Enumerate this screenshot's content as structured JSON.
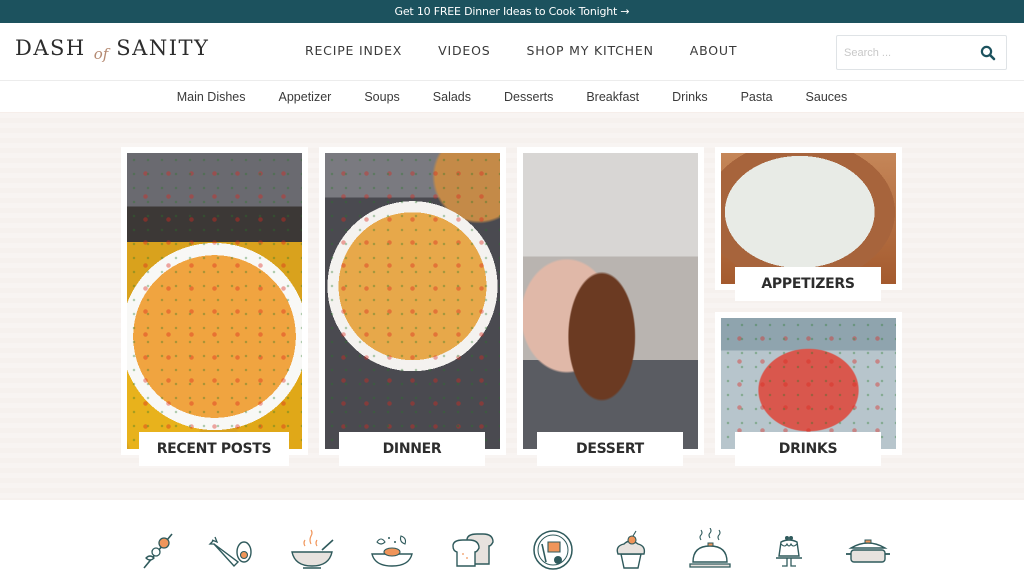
{
  "announcement": {
    "text": "Get 10 FREE Dinner Ideas to Cook Tonight →"
  },
  "header": {
    "logo": {
      "part1": "DASH",
      "part2": "of",
      "part3": "SANITY"
    },
    "nav": [
      {
        "label": "RECIPE INDEX"
      },
      {
        "label": "VIDEOS"
      },
      {
        "label": "SHOP MY KITCHEN"
      },
      {
        "label": "ABOUT"
      }
    ],
    "search": {
      "placeholder": "Search ...",
      "value": "",
      "icon": "search-icon"
    }
  },
  "subnav": [
    {
      "label": "Main Dishes"
    },
    {
      "label": "Appetizer"
    },
    {
      "label": "Soups"
    },
    {
      "label": "Salads"
    },
    {
      "label": "Desserts"
    },
    {
      "label": "Breakfast"
    },
    {
      "label": "Drinks"
    },
    {
      "label": "Pasta"
    },
    {
      "label": "Sauces"
    }
  ],
  "cards": [
    {
      "label": "RECENT POSTS",
      "image": "queso dip in white bowl with tortilla chips"
    },
    {
      "label": "DINNER",
      "image": "chicken pasta soup in white bowl"
    },
    {
      "label": "DESSERT",
      "image": "hand holding chocolate cornflake cluster"
    },
    {
      "label": "APPETIZERS",
      "image": "creamy herb dip in wooden bowl"
    },
    {
      "label": "DRINKS",
      "image": "red punch with citrus and mint in glass"
    }
  ],
  "category_icons": [
    {
      "name": "kebab-icon"
    },
    {
      "name": "vegetables-icon"
    },
    {
      "name": "soup-bowl-icon"
    },
    {
      "name": "salad-icon"
    },
    {
      "name": "bread-icon"
    },
    {
      "name": "breakfast-plate-icon"
    },
    {
      "name": "cupcake-icon"
    },
    {
      "name": "serving-cloche-icon"
    },
    {
      "name": "pudding-icon"
    },
    {
      "name": "casserole-dish-icon"
    }
  ],
  "colors": {
    "brand_teal": "#1c525e",
    "accent_orange": "#f0955a",
    "icon_stroke": "#2f5a5c",
    "logo_accent": "#b58a72",
    "hero_bg": "#f8f4f2"
  }
}
